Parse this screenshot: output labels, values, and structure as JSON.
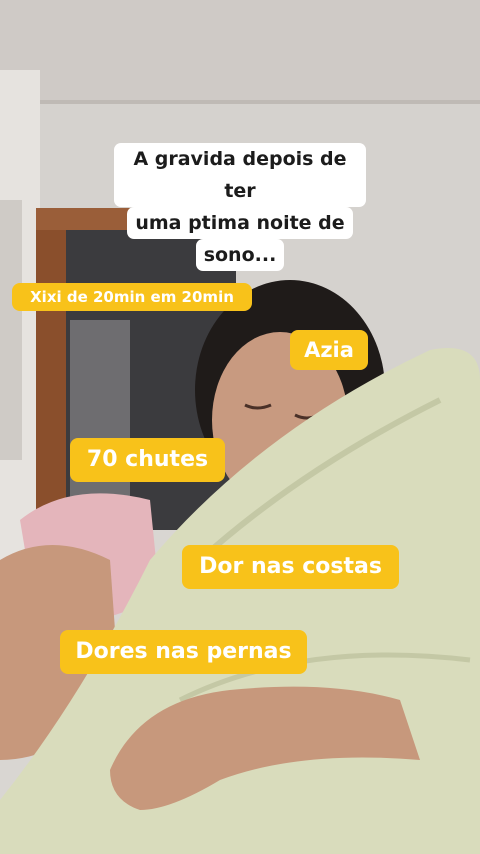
{
  "caption": {
    "line1": "A gravida depois de ter",
    "line2": "uma ptima noite de",
    "line3": "sono..."
  },
  "stickers": {
    "xixi": "Xixi de 20min em 20min",
    "azia": "Azia",
    "chutes": "70 chutes",
    "costas": "Dor nas costas",
    "pernas": "Dores nas pernas"
  },
  "colors": {
    "sticker_bg": "#f8c21a",
    "sticker_text": "#ffffff",
    "caption_bg": "#ffffff",
    "caption_text": "#1c1c1c"
  }
}
